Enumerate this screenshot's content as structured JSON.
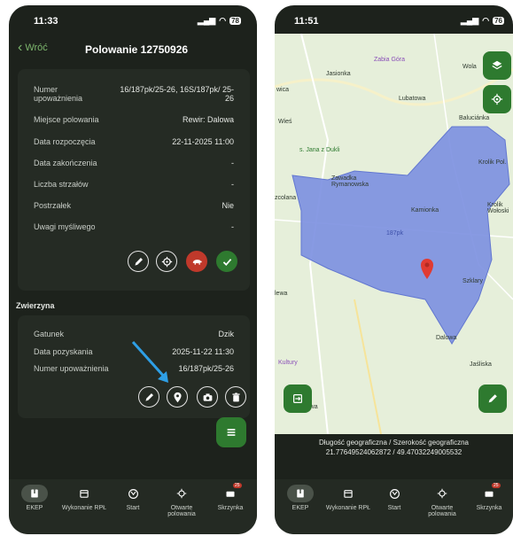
{
  "left": {
    "status": {
      "time": "11:33",
      "battery": "78"
    },
    "nav": {
      "back_label": "Wróć",
      "title": "Polowanie 12750926"
    },
    "info": {
      "rows": [
        {
          "label": "Numer upoważnienia",
          "value": "16/187pk/25-26, 16S/187pk/ 25-26"
        },
        {
          "label": "Miejsce polowania",
          "value": "Rewir: Dalowa"
        },
        {
          "label": "Data rozpoczęcia",
          "value": "22-11-2025 11:00"
        },
        {
          "label": "Data zakończenia",
          "value": "-"
        },
        {
          "label": "Liczba strzałów",
          "value": "-"
        },
        {
          "label": "Postrzałek",
          "value": "Nie"
        },
        {
          "label": "Uwagi myśliwego",
          "value": "-"
        }
      ]
    },
    "game_section": {
      "title": "Zwierzyna"
    },
    "game": {
      "rows": [
        {
          "label": "Gatunek",
          "value": "Dzik"
        },
        {
          "label": "Data pozyskania",
          "value": "2025-11-22 11:30"
        },
        {
          "label": "Numer upoważnienia",
          "value": "16/187pk/25-26"
        }
      ]
    }
  },
  "right": {
    "status": {
      "time": "11:51",
      "battery": "76"
    },
    "map": {
      "labels": [
        "Zabia Góra",
        "Jasionka",
        "Lubatowa",
        "Wola",
        "Baluciánka",
        "Wieś",
        "Zawadka Rymanowska",
        "Kamionka",
        "Krolik Pol.",
        "187pk",
        "Szklary",
        "Dalowa",
        "Jaśliska",
        "Kultury",
        "anowa",
        "wica",
        "zcolana",
        "lewa",
        "Krolik Wołoski",
        "s. Jana z Dukli"
      ],
      "coords_title": "Długość geograficzna / Szerokość geograficzna",
      "coords_value": "21.77649524062872 / 49.47032249005532"
    }
  },
  "tabs": [
    {
      "label": "EKEP",
      "icon": "book-icon"
    },
    {
      "label": "Wykonanie RPŁ",
      "icon": "calendar-icon"
    },
    {
      "label": "Start",
      "icon": "deer-icon"
    },
    {
      "label": "Otwarte polowania",
      "icon": "crosshair-icon"
    },
    {
      "label": "Skrzynka",
      "icon": "mailbox-icon",
      "badge": "25"
    }
  ],
  "colors": {
    "accent": "#2e7a2f",
    "back": "#7db66d",
    "hunt_area": "#7b8fe0",
    "danger": "#c0392b"
  }
}
